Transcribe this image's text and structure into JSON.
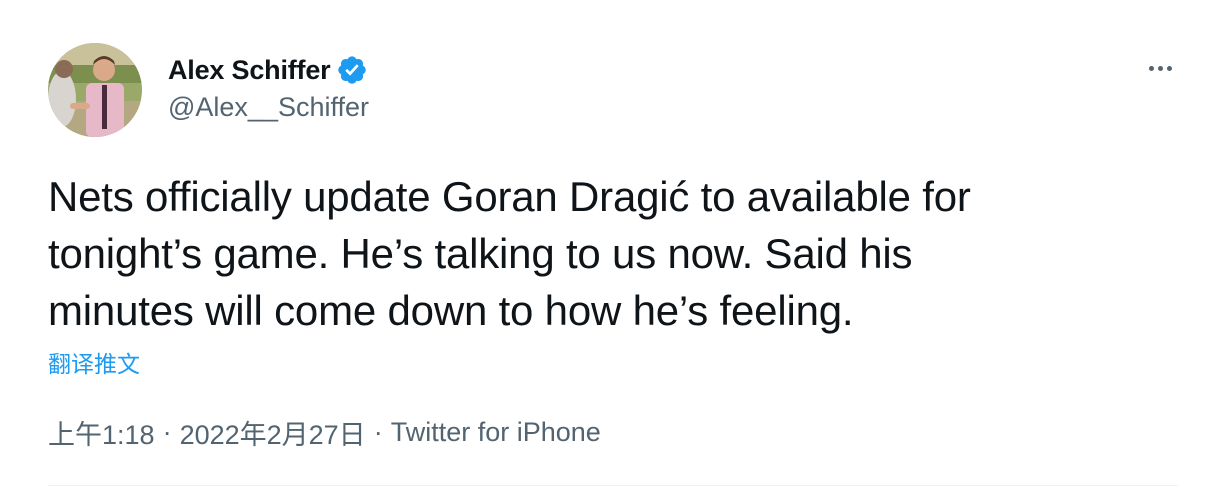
{
  "author": {
    "display_name": "Alex Schiffer",
    "handle": "@Alex__Schiffer",
    "verified": true
  },
  "tweet": {
    "lines": [
      "Nets officially update Goran Dragić to available for",
      "tonight’s game. He’s talking to us now. Said his",
      "minutes will come down to how he’s feeling."
    ],
    "translate_label": "翻译推文",
    "time": "上午1:18",
    "date": "2022年2月27日",
    "separator": "·",
    "source": "Twitter for iPhone"
  },
  "icons": {
    "more": "more-options-icon",
    "verified": "verified-badge-icon"
  },
  "colors": {
    "text": "#0f1419",
    "secondary": "#536471",
    "accent": "#1d9bf0"
  }
}
